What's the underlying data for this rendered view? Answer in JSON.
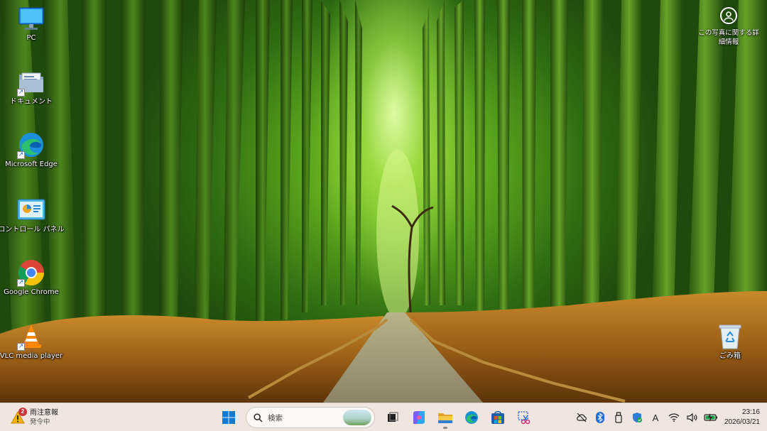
{
  "desktop": {
    "icons": [
      {
        "label": "PC",
        "icon": "pc-monitor-icon"
      },
      {
        "label": "ドキュメント",
        "icon": "documents-folder-icon"
      },
      {
        "label": "Microsoft Edge",
        "icon": "edge-icon"
      },
      {
        "label": "コントロール パネル",
        "icon": "control-panel-icon"
      },
      {
        "label": "Google Chrome",
        "icon": "chrome-icon"
      },
      {
        "label": "VLC media player",
        "icon": "vlc-icon"
      }
    ],
    "recycle_bin": {
      "label": "ごみ箱",
      "icon": "recycle-bin-icon"
    },
    "about_picture": {
      "line1": "この写真に関する詳",
      "line2": "細情報",
      "icon": "location-pin-icon"
    }
  },
  "taskbar": {
    "weather": {
      "title": "雨注意報",
      "subtitle": "発令中",
      "badge": "2",
      "icon": "weather-warning-icon"
    },
    "start": {
      "icon": "windows-start-icon"
    },
    "search": {
      "placeholder": "検索",
      "icon": "search-icon"
    },
    "apps": [
      {
        "name": "task-view",
        "icon": "task-view-icon"
      },
      {
        "name": "copilot",
        "icon": "copilot-icon"
      },
      {
        "name": "file-explorer",
        "icon": "file-explorer-icon",
        "active": true
      },
      {
        "name": "edge",
        "icon": "edge-icon"
      },
      {
        "name": "microsoft-store",
        "icon": "store-icon"
      },
      {
        "name": "snipping-tool",
        "icon": "snipping-tool-icon"
      }
    ],
    "tray": {
      "icons": [
        "cloud-off-icon",
        "bluetooth-icon",
        "usb-drive-icon",
        "security-icon",
        "ime-icon",
        "wifi-icon",
        "volume-icon",
        "battery-icon"
      ],
      "ime_label": "A",
      "time": "23:16",
      "date": "2026/03/21"
    }
  },
  "colors": {
    "taskbar_bg": "#f0e6df",
    "windows_blue": "#0a7ad6",
    "bamboo_green": "#5aa61c"
  }
}
